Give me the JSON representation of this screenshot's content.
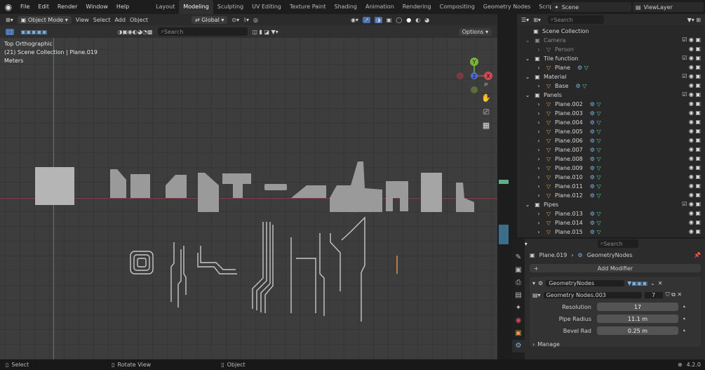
{
  "topbar": {
    "menu": [
      "File",
      "Edit",
      "Render",
      "Window",
      "Help"
    ],
    "workspaces": [
      "Layout",
      "Modeling",
      "Sculpting",
      "UV Editing",
      "Texture Paint",
      "Shading",
      "Animation",
      "Rendering",
      "Compositing",
      "Geometry Nodes",
      "Scripting"
    ],
    "active_workspace": "Modeling",
    "scene": "Scene",
    "view_layer": "ViewLayer"
  },
  "viewport": {
    "mode": "Object Mode",
    "menus": [
      "View",
      "Select",
      "Add",
      "Object"
    ],
    "transform": "Global",
    "search_placeholder": "Search",
    "options": "Options",
    "view_name": "Top Orthographic",
    "collection_info": "(21) Scene Collection | Plane.019",
    "units": "Meters",
    "gizmo": {
      "x": "X",
      "y": "Y",
      "z": "Z"
    }
  },
  "outliner": {
    "search_placeholder": "Search",
    "items": [
      {
        "name": "Scene Collection",
        "type": "collection-root"
      },
      {
        "name": "Camera",
        "type": "collection",
        "dim": true
      },
      {
        "name": "Person",
        "type": "object",
        "dim": true
      },
      {
        "name": "Tile function",
        "type": "collection"
      },
      {
        "name": "Plane",
        "type": "mesh"
      },
      {
        "name": "Material",
        "type": "collection"
      },
      {
        "name": "Base",
        "type": "mesh"
      },
      {
        "name": "Panels",
        "type": "collection"
      },
      {
        "name": "Plane.002",
        "type": "mesh"
      },
      {
        "name": "Plane.003",
        "type": "mesh"
      },
      {
        "name": "Plane.004",
        "type": "mesh"
      },
      {
        "name": "Plane.005",
        "type": "mesh"
      },
      {
        "name": "Plane.006",
        "type": "mesh"
      },
      {
        "name": "Plane.007",
        "type": "mesh"
      },
      {
        "name": "Plane.008",
        "type": "mesh"
      },
      {
        "name": "Plane.009",
        "type": "mesh"
      },
      {
        "name": "Plane.010",
        "type": "mesh"
      },
      {
        "name": "Plane.011",
        "type": "mesh"
      },
      {
        "name": "Plane.012",
        "type": "mesh"
      },
      {
        "name": "Pipes",
        "type": "collection"
      },
      {
        "name": "Plane.013",
        "type": "mesh"
      },
      {
        "name": "Plane.014",
        "type": "mesh"
      },
      {
        "name": "Plane.015",
        "type": "mesh"
      }
    ]
  },
  "properties": {
    "search_placeholder": "Search",
    "object": "Plane.019",
    "modifier_tab": "GeometryNodes",
    "add_modifier": "Add Modifier",
    "modifier_name": "GeometryNodes",
    "node_group": "Geometry Nodes.003",
    "node_users": "7",
    "fields": [
      {
        "label": "Resolution",
        "value": "17"
      },
      {
        "label": "Pipe Radius",
        "value": "11.1 m"
      },
      {
        "label": "Bevel Rad",
        "value": "0.25 m"
      }
    ],
    "manage": "Manage"
  },
  "status": {
    "select": "Select",
    "rotate": "Rotate View",
    "object": "Object",
    "version": "4.2.0"
  }
}
